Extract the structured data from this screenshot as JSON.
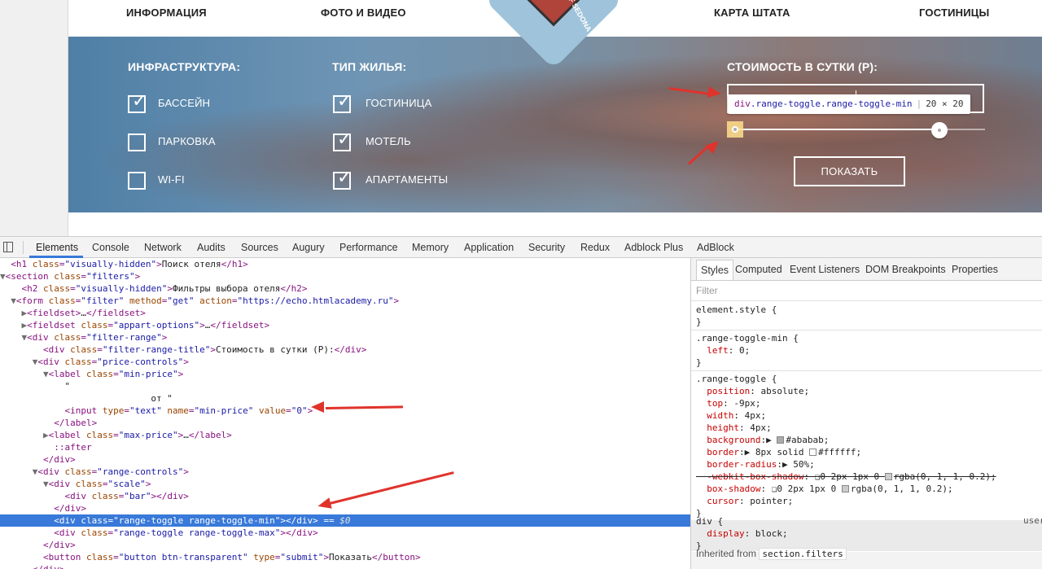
{
  "nav": {
    "info": "ИНФОРМАЦИЯ",
    "photo_video": "ФОТО И ВИДЕО",
    "state_map": "КАРТА ШТАТА",
    "hotels": "ГОСТИНИЦЫ",
    "logo_text": "CITY OF SEDONA"
  },
  "filters": {
    "infrastructure_title": "ИНФРАСТРУКТУРА:",
    "infrastructure": [
      {
        "label": "БАССЕЙН",
        "checked": true
      },
      {
        "label": "ПАРКОВКА",
        "checked": false
      },
      {
        "label": "WI-FI",
        "checked": false
      }
    ],
    "housing_title": "ТИП ЖИЛЬЯ:",
    "housing": [
      {
        "label": "ГОСТИНИЦА",
        "checked": true
      },
      {
        "label": "МОТЕЛЬ",
        "checked": true
      },
      {
        "label": "АПАРТАМЕНТЫ",
        "checked": true
      }
    ],
    "price_title": "СТОИМОСТЬ В СУТКИ (Р):",
    "show_button": "ПОКАЗАТЬ"
  },
  "tooltip": {
    "tag": "div",
    "classes": ".range-toggle.range-toggle-min",
    "size": "20 × 20"
  },
  "devtools": {
    "tabs": [
      "Elements",
      "Console",
      "Network",
      "Audits",
      "Sources",
      "Augury",
      "Performance",
      "Memory",
      "Application",
      "Security",
      "Redux",
      "Adblock Plus",
      "AdBlock"
    ],
    "active_tab": "Elements",
    "styles_tabs": [
      "Styles",
      "Computed",
      "Event Listeners",
      "DOM Breakpoints",
      "Properties"
    ],
    "filter_placeholder": "Filter",
    "inherited_label": "Inherited from",
    "inherited_selector": "section.filters",
    "user_agent_label": "user"
  },
  "colors": {
    "selected_row": "#3879d9",
    "annotation_arrow": "#e0332b"
  }
}
